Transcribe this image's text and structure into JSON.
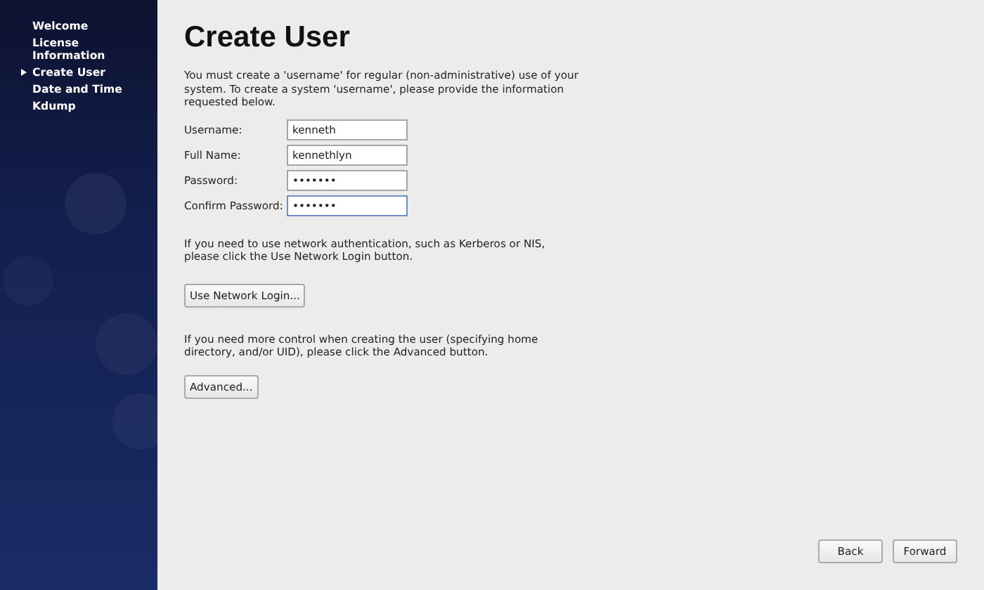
{
  "sidebar": {
    "items": [
      {
        "label": "Welcome",
        "selected": false
      },
      {
        "label": "License Information",
        "selected": false
      },
      {
        "label": "Create User",
        "selected": true
      },
      {
        "label": "Date and Time",
        "selected": false
      },
      {
        "label": "Kdump",
        "selected": false
      }
    ]
  },
  "title": "Create User",
  "intro": "You must create a 'username' for regular (non-administrative) use of your system.  To create a system 'username', please provide the information requested below.",
  "fields": [
    {
      "label": "Username:",
      "value": "kenneth",
      "focused": false
    },
    {
      "label": "Full Name:",
      "value": "kennethlyn",
      "focused": false
    },
    {
      "label": "Password:",
      "value": "•••••••",
      "focused": false
    },
    {
      "label": "Confirm Password:",
      "value": "•••••••",
      "focused": true
    }
  ],
  "network_text": "If you need to use network authentication, such as Kerberos or NIS, please click the Use Network Login button.",
  "network_button": "Use Network Login...",
  "advanced_text": "If you need more control when creating the user (specifying home directory, and/or UID), please click the Advanced button.",
  "advanced_button": "Advanced...",
  "nav_buttons": [
    "Back",
    "Forward"
  ]
}
